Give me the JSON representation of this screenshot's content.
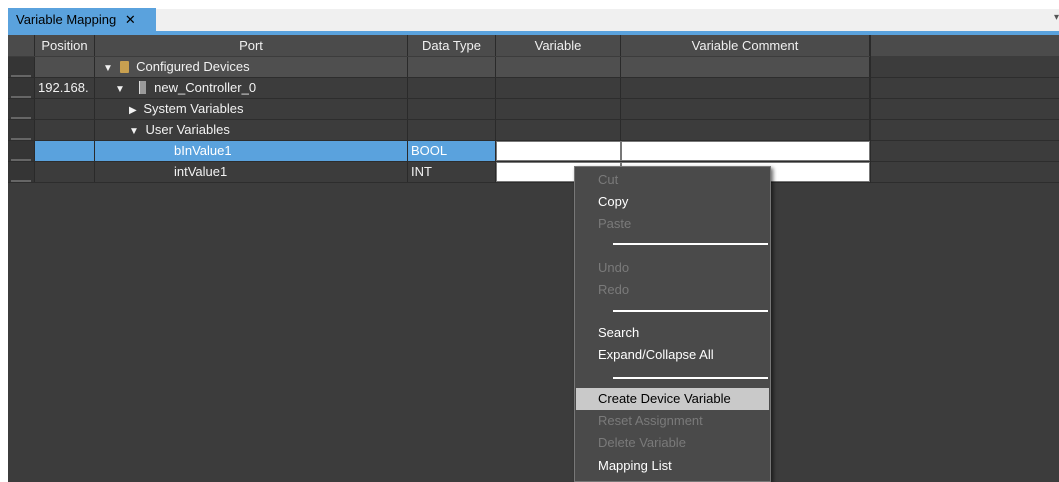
{
  "tab": {
    "title": "Variable Mapping",
    "close_glyph": "✕",
    "overflow_glyph": "▾"
  },
  "columns": [
    "Position",
    "Port",
    "Data Type",
    "Variable",
    "Variable Comment"
  ],
  "rows": [
    {
      "position": "",
      "port": "Configured Devices",
      "data_type": ""
    },
    {
      "position": "192.168.",
      "port": "new_Controller_0",
      "data_type": ""
    },
    {
      "position": "",
      "port": "System Variables",
      "data_type": ""
    },
    {
      "position": "",
      "port": "User Variables",
      "data_type": ""
    },
    {
      "position": "",
      "port": "bInValue1",
      "data_type": "BOOL"
    },
    {
      "position": "",
      "port": "intValue1",
      "data_type": "INT"
    }
  ],
  "glyphs": {
    "expanded": "▼",
    "collapsed": "▶"
  },
  "context_menu": {
    "items": [
      {
        "label": "Cut",
        "enabled": false
      },
      {
        "label": "Copy",
        "enabled": true
      },
      {
        "label": "Paste",
        "enabled": false
      },
      {
        "label": "Undo",
        "enabled": false
      },
      {
        "label": "Redo",
        "enabled": false
      },
      {
        "label": "Search",
        "enabled": true
      },
      {
        "label": "Expand/Collapse All",
        "enabled": true
      },
      {
        "label": "Create Device Variable",
        "enabled": true,
        "highlighted": true
      },
      {
        "label": "Reset Assignment",
        "enabled": false
      },
      {
        "label": "Delete Variable",
        "enabled": false
      },
      {
        "label": "Mapping List",
        "enabled": true
      }
    ]
  },
  "colors": {
    "accent": "#5aa2dd",
    "grid_bg": "#3c3c3c",
    "menu_bg": "#4a4a4a"
  }
}
